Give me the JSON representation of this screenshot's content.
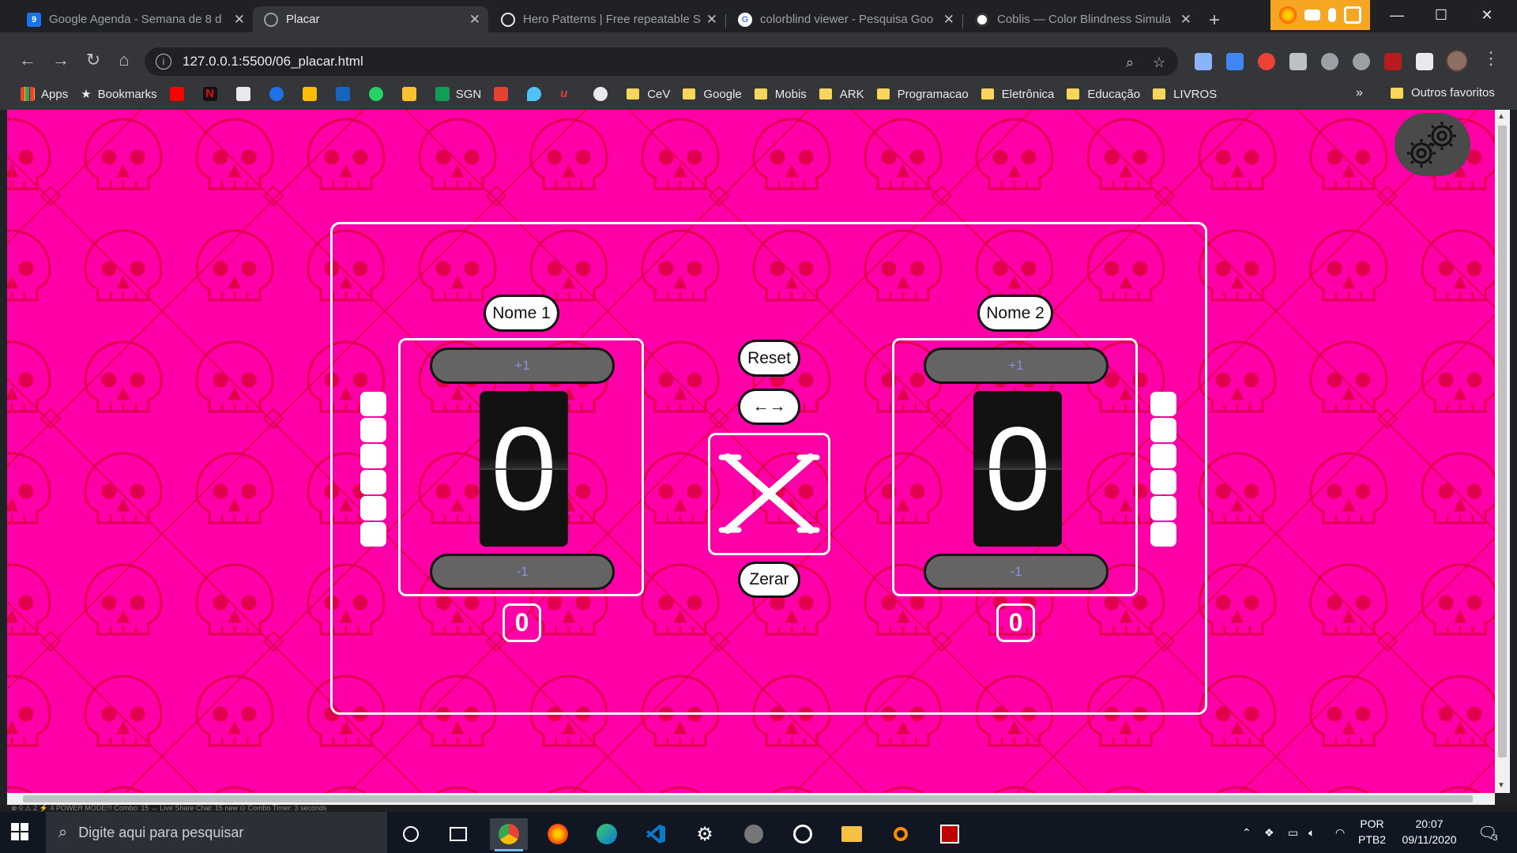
{
  "browser": {
    "tabs": [
      {
        "title": "Google Agenda - Semana de 8 d",
        "favicon": "google-calendar-icon",
        "active": false
      },
      {
        "title": "Placar",
        "favicon": "globe-icon",
        "active": true
      },
      {
        "title": "Hero Patterns | Free repeatable S",
        "favicon": "globe-icon",
        "active": false
      },
      {
        "title": "colorblind viewer - Pesquisa Goo",
        "favicon": "google-icon",
        "active": false
      },
      {
        "title": "Coblis — Color Blindness Simula",
        "favicon": "coblis-icon",
        "active": false
      }
    ],
    "url": "127.0.0.1:5500/06_placar.html",
    "bookmarks": {
      "apps_label": "Apps",
      "bookmarks_label": "Bookmarks",
      "sgn_label": "SGN",
      "folders": [
        "CeV",
        "Google",
        "Mobis",
        "ARK",
        "Programacao",
        "Eletrônica",
        "Educação",
        "LIVROS"
      ],
      "more_label": "»",
      "other_label": "Outros favoritos"
    }
  },
  "page": {
    "background_color": "#ff00a8",
    "pattern_color": "#e0004e",
    "team1": {
      "name": "Nome 1",
      "plus": "+1",
      "minus": "-1",
      "score": "0",
      "sets_total": "0"
    },
    "team2": {
      "name": "Nome 2",
      "plus": "+1",
      "minus": "-1",
      "score": "0",
      "sets_total": "0"
    },
    "center": {
      "reset": "Reset",
      "swap": "←→",
      "versus": "X",
      "clear": "Zerar"
    }
  },
  "status_bar_text": "⊗ 0 ⚠ 2   ⚡ 4   POWER MODE!!! Combo: 15   ↔ Live Share Chat: 15 new   ⊙ Combo Timer: 3 seconds",
  "taskbar": {
    "search_placeholder": "Digite aqui para pesquisar",
    "language": "POR",
    "layout": "PTB2",
    "time": "20:07",
    "date": "09/11/2020",
    "notifications": "3"
  }
}
